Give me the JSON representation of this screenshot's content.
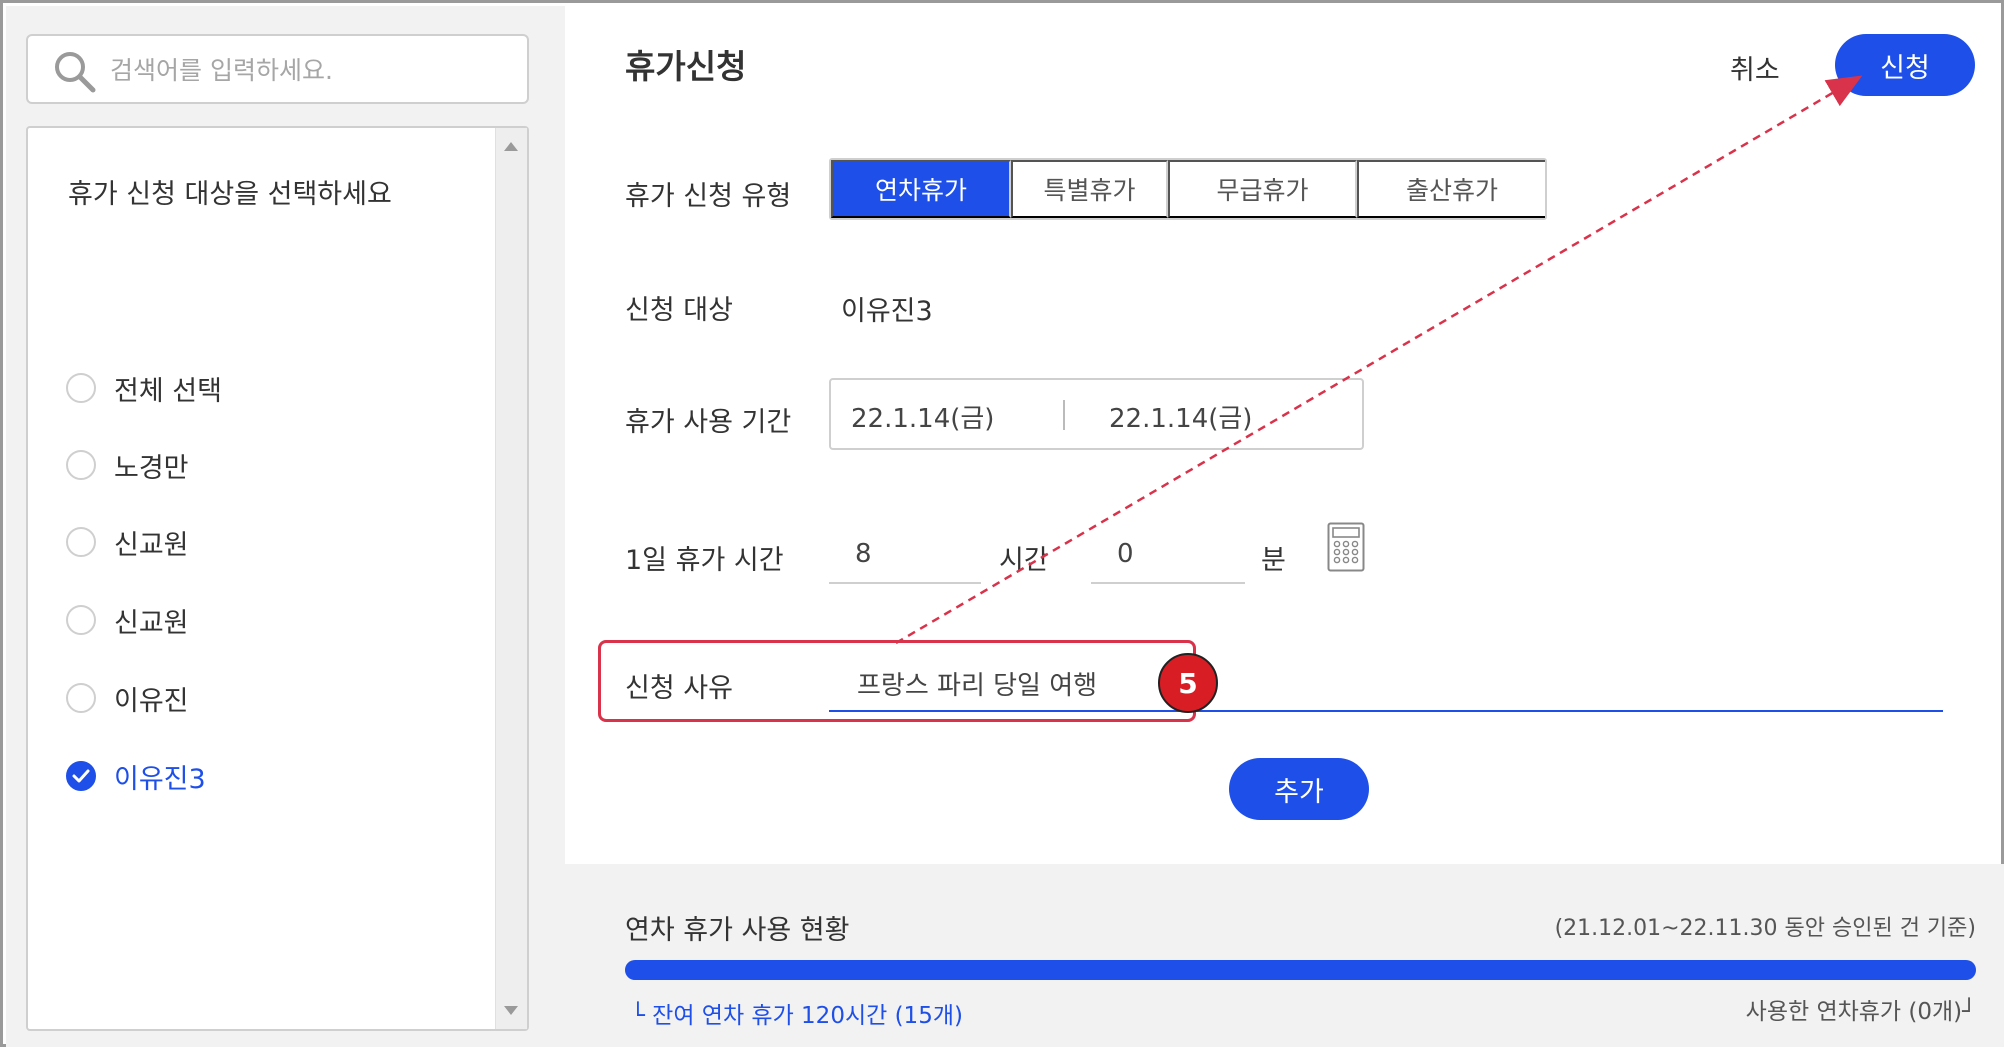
{
  "search": {
    "placeholder": "검색어를 입력하세요."
  },
  "target_list": {
    "title": "휴가 신청 대상을 선택하세요",
    "items": [
      {
        "label": "전체 선택",
        "checked": false
      },
      {
        "label": "노경만",
        "checked": false
      },
      {
        "label": "신교원",
        "checked": false
      },
      {
        "label": "신교원",
        "checked": false
      },
      {
        "label": "이유진",
        "checked": false
      },
      {
        "label": "이유진3",
        "checked": true
      }
    ]
  },
  "header": {
    "title": "휴가신청",
    "cancel_label": "취소",
    "submit_label": "신청"
  },
  "form": {
    "type_label": "휴가 신청 유형",
    "types": [
      "연차휴가",
      "특별휴가",
      "무급휴가",
      "출산휴가"
    ],
    "active_type": "연차휴가",
    "target_label": "신청 대상",
    "target_value": "이유진3",
    "period_label": "휴가 사용 기간",
    "period_start": "22.1.14(금)",
    "period_end": "22.1.14(금)",
    "daily_label": "1일 휴가 시간",
    "hours_value": "8",
    "hours_unit": "시간",
    "minutes_value": "0",
    "minutes_unit": "분",
    "reason_label": "신청 사유",
    "reason_value": "프랑스 파리 당일 여행",
    "step_number": "5",
    "add_label": "추가"
  },
  "usage": {
    "title": "연차 휴가 사용 현황",
    "period_note": "(21.12.01~22.11.30 동안 승인된 건 기준)",
    "remaining_label": "└ 잔여 연차 휴가 120시간 (15개)",
    "used_label": "사용한 연차휴가 (0개)┘",
    "remaining_fraction": 1.0
  },
  "colors": {
    "accent": "#1e4fe8",
    "highlight": "#d9334b",
    "badge": "#d91d25"
  }
}
